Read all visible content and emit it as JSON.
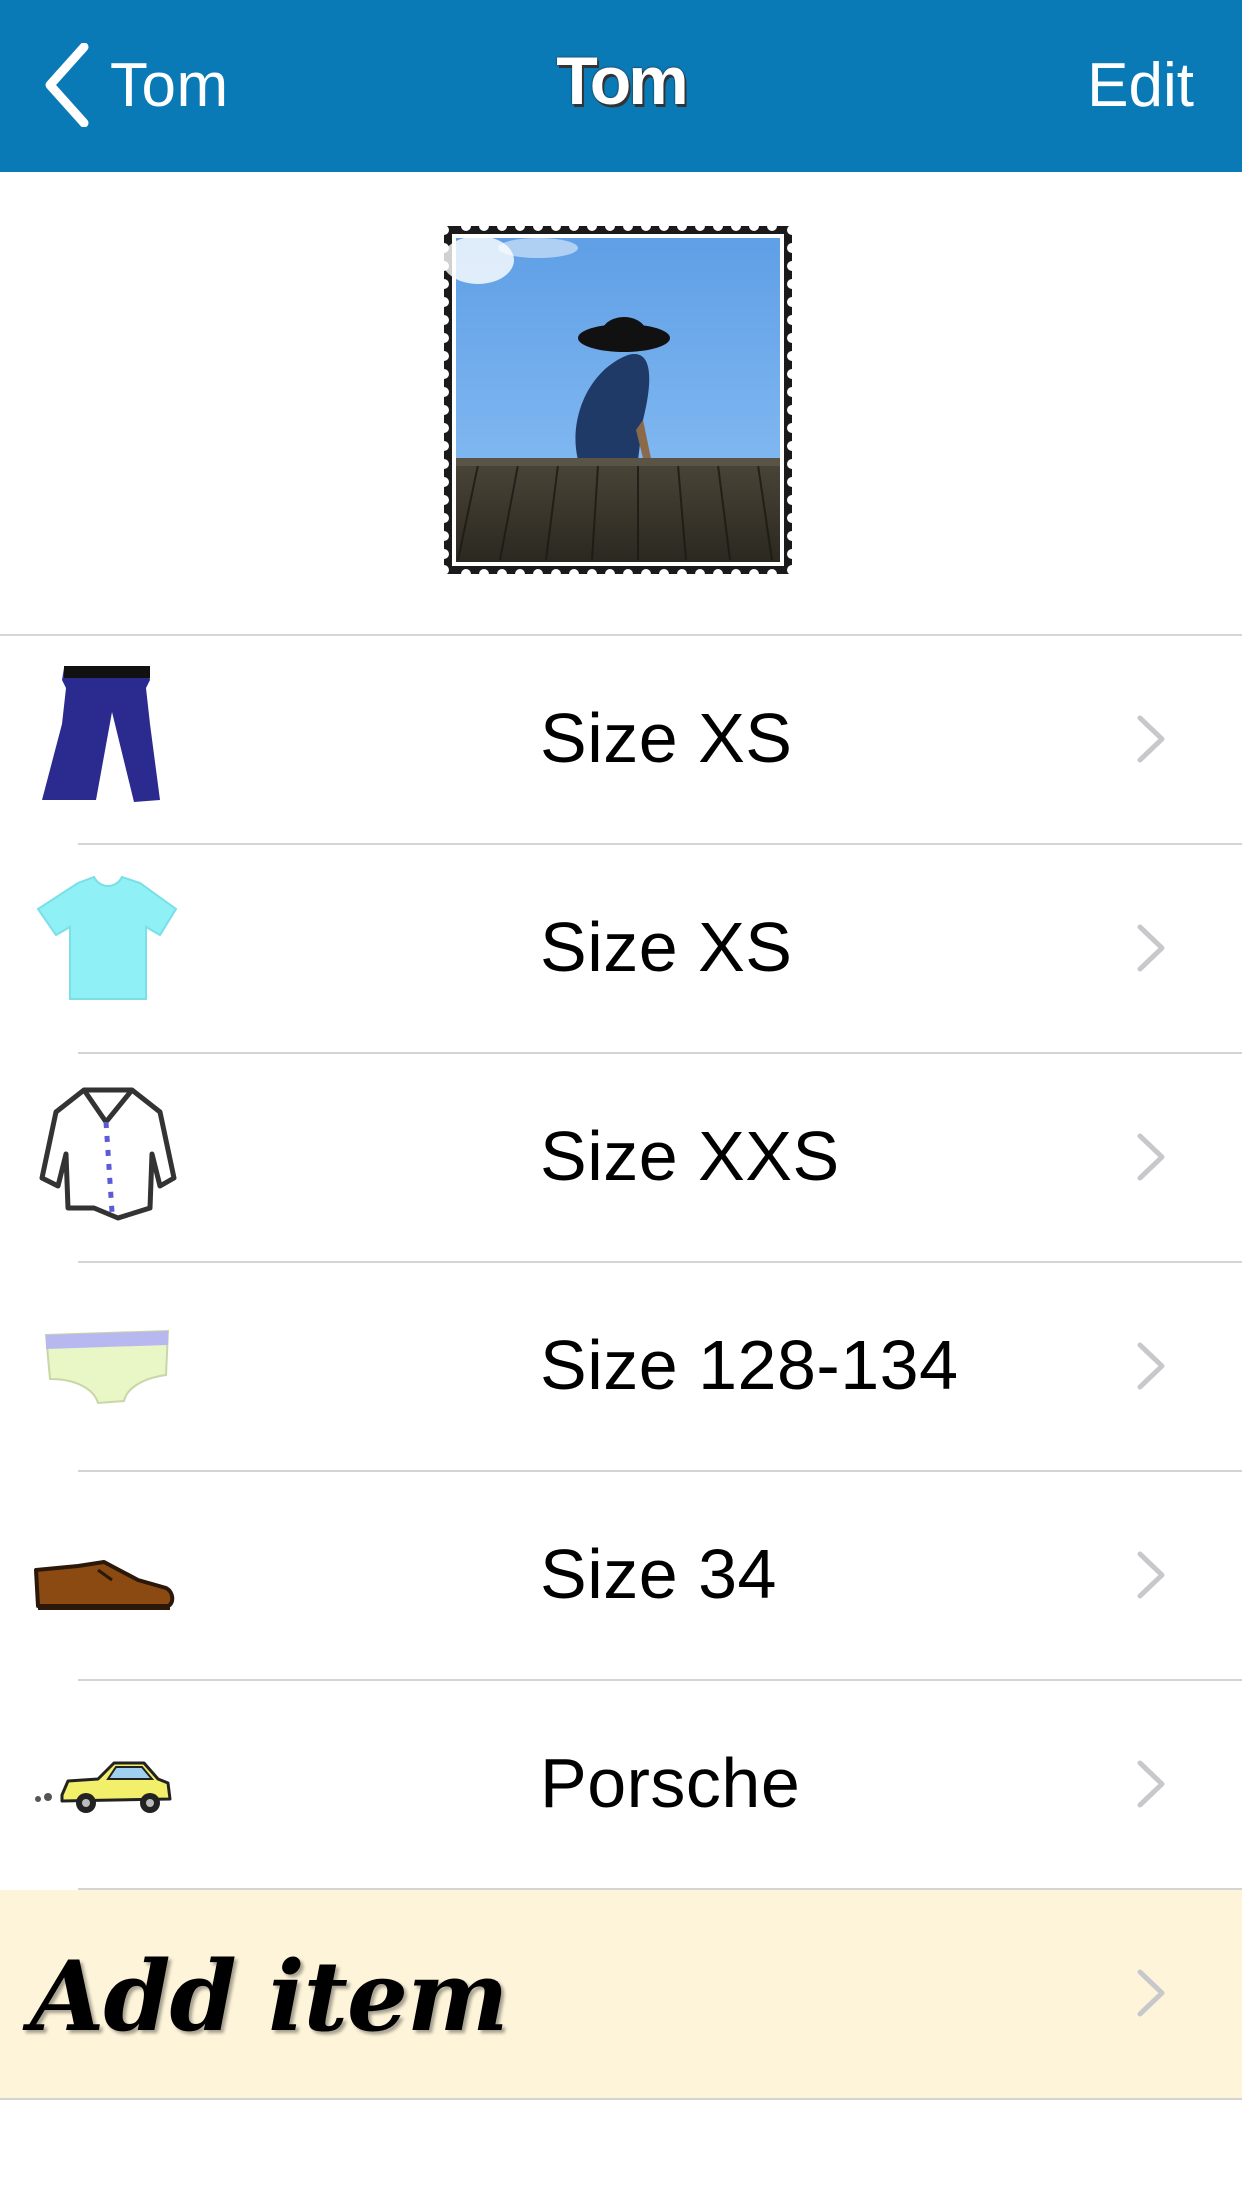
{
  "nav": {
    "back_label": "Tom",
    "title": "Tom",
    "edit_label": "Edit"
  },
  "items": [
    {
      "icon": "pants-icon",
      "label": "Size XS"
    },
    {
      "icon": "tshirt-icon",
      "label": "Size XS"
    },
    {
      "icon": "shirt-icon",
      "label": "Size XXS"
    },
    {
      "icon": "underwear-icon",
      "label": "Size 128-134"
    },
    {
      "icon": "shoe-icon",
      "label": "Size 34"
    },
    {
      "icon": "car-icon",
      "label": "Porsche"
    }
  ],
  "add_item": {
    "label": "Add item"
  },
  "colors": {
    "nav_background": "#0a7ab7",
    "add_row_background": "#fdf4d9",
    "chevron": "#c7c7cc"
  }
}
